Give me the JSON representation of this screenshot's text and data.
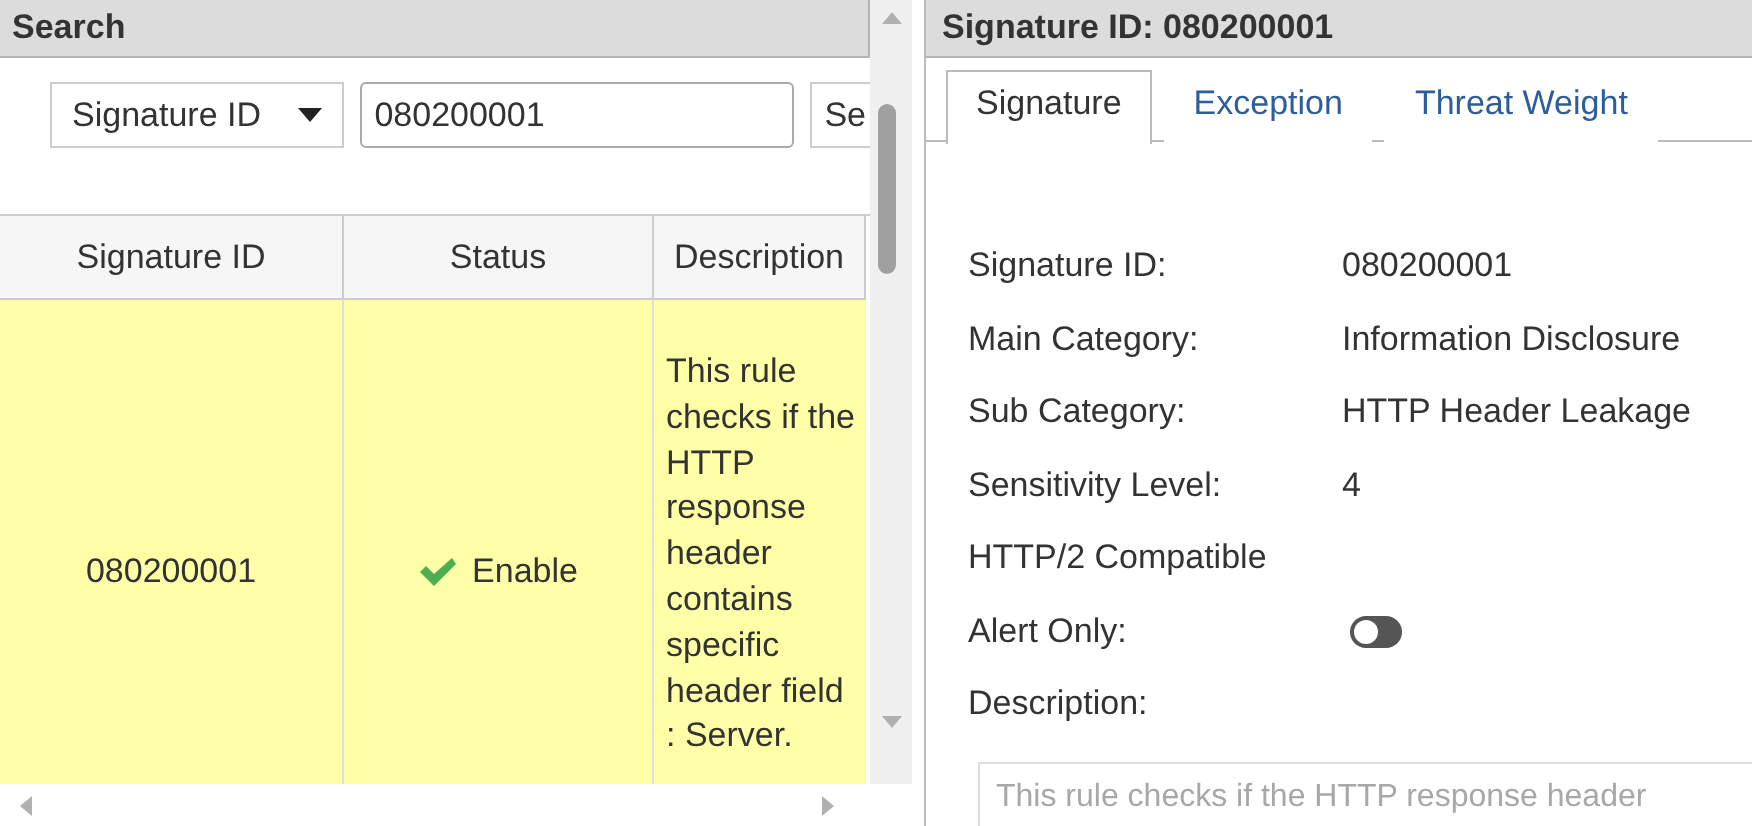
{
  "search_panel": {
    "title": "Search",
    "filter_select": "Signature ID",
    "search_input": "080200001",
    "search_button": "Se",
    "table": {
      "columns": [
        "Signature ID",
        "Status",
        "Description"
      ],
      "rows": [
        {
          "selected": true,
          "signature_id": "080200001",
          "status": "Enable",
          "enabled": true,
          "description": "This rule checks if the HTTP response header contains specific header field : Server."
        }
      ]
    }
  },
  "detail_panel": {
    "title": "Signature ID: 080200001",
    "tabs": [
      {
        "label": "Signature",
        "selected": true
      },
      {
        "label": "Exception",
        "selected": false
      },
      {
        "label": "Threat Weight",
        "selected": false
      }
    ],
    "fields": [
      {
        "kind": "text",
        "label": "Signature ID:",
        "value": "080200001"
      },
      {
        "kind": "text",
        "label": "Main Category:",
        "value": "Information Disclosure"
      },
      {
        "kind": "text",
        "label": "Sub Category:",
        "value": "HTTP Header Leakage"
      },
      {
        "kind": "text",
        "label": "Sensitivity Level:",
        "value": "4"
      },
      {
        "kind": "text",
        "label": "HTTP/2 Compatible"
      },
      {
        "kind": "toggle",
        "label": "Alert Only:",
        "on": false
      },
      {
        "kind": "text",
        "label": "Description:"
      }
    ],
    "description_field": {
      "value": "This rule checks if the HTTP response header",
      "disabled": true
    }
  }
}
